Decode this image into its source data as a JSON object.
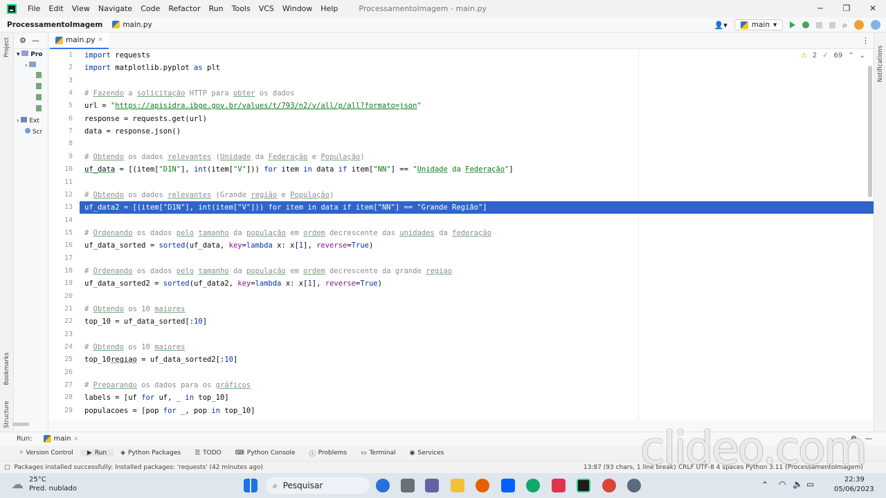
{
  "window": {
    "menu": [
      "File",
      "Edit",
      "View",
      "Navigate",
      "Code",
      "Refactor",
      "Run",
      "Tools",
      "VCS",
      "Window",
      "Help"
    ],
    "title": "ProcessamentoImagem - main.py",
    "min": "─",
    "max": "❐",
    "close": "✕"
  },
  "navbar": {
    "project": "ProcessamentoImagem",
    "file": "main.py",
    "branch": "main"
  },
  "project_panel": {
    "items": [
      "Pro",
      "",
      "",
      "",
      "",
      "",
      "Ext",
      "Scr"
    ]
  },
  "left_strip": {
    "project": "Project",
    "bookmarks": "Bookmarks",
    "structure": "Structure"
  },
  "right_strip": {
    "notifications": "Notifications"
  },
  "tab": {
    "label": "main.py"
  },
  "inspections": {
    "warnings": "2",
    "ok": "69"
  },
  "editor": {
    "highlighted_line": 13,
    "lines": [
      {
        "n": "1",
        "html": "<span class='kw'>import</span> requests"
      },
      {
        "n": "2",
        "html": "<span class='kw'>import</span> matplotlib.pyplot <span class='kw'>as</span> plt"
      },
      {
        "n": "3",
        "html": ""
      },
      {
        "n": "4",
        "html": "<span class='cm'># <span class='ul'>Fazendo</span> a <span class='ul'>solicitação</span> HTTP para <span class='ul'>obter</span> os dados</span>"
      },
      {
        "n": "5",
        "html": "url = <span class='st'>\"<span class='url'>https://apisidra.ibge.gov.br/values/t/793/n2/v/all/p/all?formato=json</span>\"</span>"
      },
      {
        "n": "6",
        "html": "response = requests.get(url)"
      },
      {
        "n": "7",
        "html": "data = response.json()"
      },
      {
        "n": "8",
        "html": ""
      },
      {
        "n": "9",
        "html": "<span class='cm'># <span class='ul'>Obtendo</span> os dados <span class='ul'>relevantes</span> (<span class='ul'>Unidade</span> da <span class='ul'>Federação</span> e <span class='ul'>População</span>)</span>"
      },
      {
        "n": "10",
        "html": "<span class='ul'>uf_data</span> = [(item[<span class='st'>\"D1N\"</span>], <span class='kw'>int</span>(item[<span class='st'>\"V\"</span>])) <span class='kw'>for</span> item <span class='kw'>in</span> data <span class='kw'>if</span> item[<span class='st'>\"NN\"</span>] == <span class='st'>\"<span class='ul'>Unidade</span> da <span class='ul'>Federação</span>\"</span>]"
      },
      {
        "n": "11",
        "html": ""
      },
      {
        "n": "12",
        "html": "<span class='cm'># <span class='ul'>Obtendo</span> os dados <span class='ul'>relevantes</span> (Grande <span class='ul'>região</span> e <span class='ul'>População</span>)</span>"
      },
      {
        "n": "13",
        "html": "<span class='hlt'>uf_data2 = [(item[\"D1N\"], int(item[\"V\"])) for item in data if item[\"NN\"] == \"Grande Região\"]</span>"
      },
      {
        "n": "14",
        "html": ""
      },
      {
        "n": "15",
        "html": "<span class='cm'># <span class='ul'>Ordenando</span> os dados <span class='ul'>pelo</span> <span class='ul'>tamanho</span> da <span class='ul'>população</span> em <span class='ul'>ordem</span> decrescente das <span class='ul'>unidades</span> da <span class='ul'>federação</span></span>"
      },
      {
        "n": "16",
        "html": "uf_data_sorted = <span class='kw'>sorted</span>(uf_data, <span class='pm'>key</span>=<span class='kw'>lambda</span> x: x[<span class='kw'>1</span>], <span class='pm'>reverse</span>=<span class='kw'>True</span>)"
      },
      {
        "n": "17",
        "html": ""
      },
      {
        "n": "18",
        "html": "<span class='cm'># <span class='ul'>Ordenando</span> os dados <span class='ul'>pelo</span> <span class='ul'>tamanho</span> da <span class='ul'>população</span> em <span class='ul'>ordem</span> decrescente da grande <span class='ul'>regiao</span></span>"
      },
      {
        "n": "19",
        "html": "uf_data_sorted2 = <span class='kw'>sorted</span>(uf_data2, <span class='pm'>key</span>=<span class='kw'>lambda</span> x: x[<span class='kw'>1</span>], <span class='pm'>reverse</span>=<span class='kw'>True</span>)"
      },
      {
        "n": "20",
        "html": ""
      },
      {
        "n": "21",
        "html": "<span class='cm'># <span class='ul'>Obtendo</span> os 10 <span class='ul'>maiores</span></span>"
      },
      {
        "n": "22",
        "html": "top_10 = uf_data_sorted[:<span class='kw'>10</span>]"
      },
      {
        "n": "23",
        "html": ""
      },
      {
        "n": "24",
        "html": "<span class='cm'># <span class='ul'>Obtendo</span> os 10 <span class='ul'>maiores</span></span>"
      },
      {
        "n": "25",
        "html": "top_10<span class='ul'>regiao</span> = uf_data_sorted2[:<span class='kw'>10</span>]"
      },
      {
        "n": "26",
        "html": ""
      },
      {
        "n": "27",
        "html": "<span class='cm'># <span class='ul'>Preparando</span> os dados para os <span class='ul'>gráficos</span></span>"
      },
      {
        "n": "28",
        "html": "labels = [uf <span class='kw'>for</span> uf, _ <span class='kw'>in</span> top_10]"
      },
      {
        "n": "29",
        "html": "populacoes = [pop <span class='kw'>for</span> _, pop <span class='kw'>in</span> top_10]"
      }
    ]
  },
  "runbar": {
    "label": "Run:",
    "config": "main"
  },
  "bottom_tools": [
    "Version Control",
    "Run",
    "Python Packages",
    "TODO",
    "Python Console",
    "Problems",
    "Terminal",
    "Services"
  ],
  "status": {
    "message": "Packages installed successfully: Installed packages: 'requests' (42 minutes ago)",
    "position": "13:87 (93 chars, 1 line break)",
    "rest": "CRLF   UTF-8   4 spaces   Python 3.11 (ProcessamentoImagem)"
  },
  "watermark": "clideo.com",
  "taskbar": {
    "temp": "25°C",
    "weather": "Pred. nublado",
    "search": "Pesquisar",
    "time": "22:39",
    "date": "05/06/2023"
  }
}
